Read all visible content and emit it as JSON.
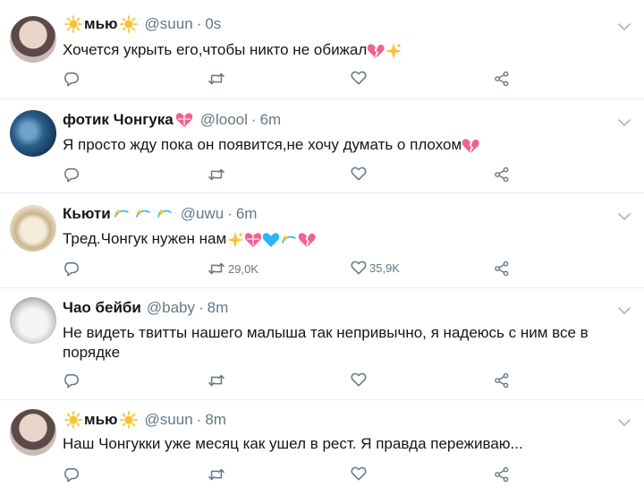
{
  "tweets": [
    {
      "name": "мью",
      "handle": "@suun",
      "time": "0s",
      "text": "Хочется укрыть его,чтобы никто не обижал",
      "retweets": "",
      "likes": "",
      "name_icons": [
        "sun-emoji",
        "sun-emoji"
      ],
      "text_icons": [
        "broken-heart-emoji",
        "sparkles-emoji"
      ]
    },
    {
      "name": "фотик Чонгука",
      "handle": "@loool",
      "time": "6m",
      "text": "Я просто жду пока он появится,не хочу думать о плохом",
      "retweets": "",
      "likes": "",
      "name_icons": [
        "heart-with-ribbon-emoji"
      ],
      "text_icons": [
        "broken-heart-emoji"
      ]
    },
    {
      "name": "Кьюти",
      "handle": "@uwu",
      "time": "6m",
      "text": "Тред.Чонгук нужен нам",
      "retweets": "29,0K",
      "likes": "35,9K",
      "name_icons": [
        "dizzy-emoji",
        "dizzy-emoji",
        "dizzy-emoji"
      ],
      "text_icons": [
        "sparkles-emoji",
        "heart-with-ribbon-emoji",
        "blue-heart-emoji",
        "dizzy-emoji",
        "broken-heart-emoji"
      ]
    },
    {
      "name": "Чао бейби",
      "handle": "@baby",
      "time": "8m",
      "text": "Не видеть твитты нашего малыша так непривычно, я надеюсь с ним все в порядке",
      "retweets": "",
      "likes": "",
      "name_icons": [],
      "text_icons": []
    },
    {
      "name": "мью",
      "handle": "@suun",
      "time": "8m",
      "text": "Наш Чонгукки уже месяц как ушел в рест. Я правда переживаю...",
      "retweets": "",
      "likes": "",
      "name_icons": [
        "sun-emoji",
        "sun-emoji"
      ],
      "text_icons": []
    }
  ],
  "separator": "·",
  "colors": {
    "text": "#14171a",
    "muted": "#657786",
    "divider": "#e6ecf0",
    "sun": "#f7c331",
    "pink": "#f06292",
    "blue": "#29b6f6"
  }
}
